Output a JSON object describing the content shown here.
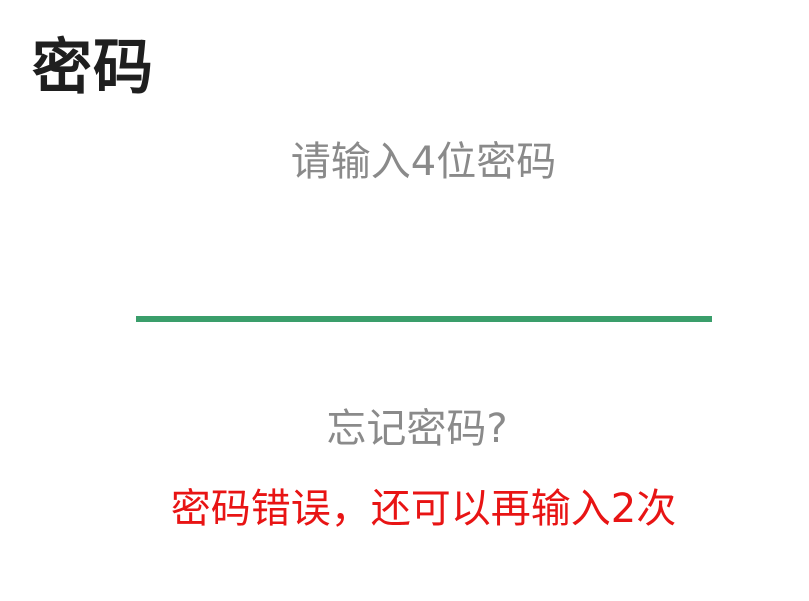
{
  "header": {
    "title": "密码"
  },
  "pin": {
    "prompt": "请输入4位密码",
    "value": "",
    "placeholder": "",
    "underline_color": "#3a9e6b"
  },
  "links": {
    "forgot_password": "忘记密码?"
  },
  "status": {
    "error": "密码错误，还可以再输入2次",
    "error_color": "#e81414"
  }
}
